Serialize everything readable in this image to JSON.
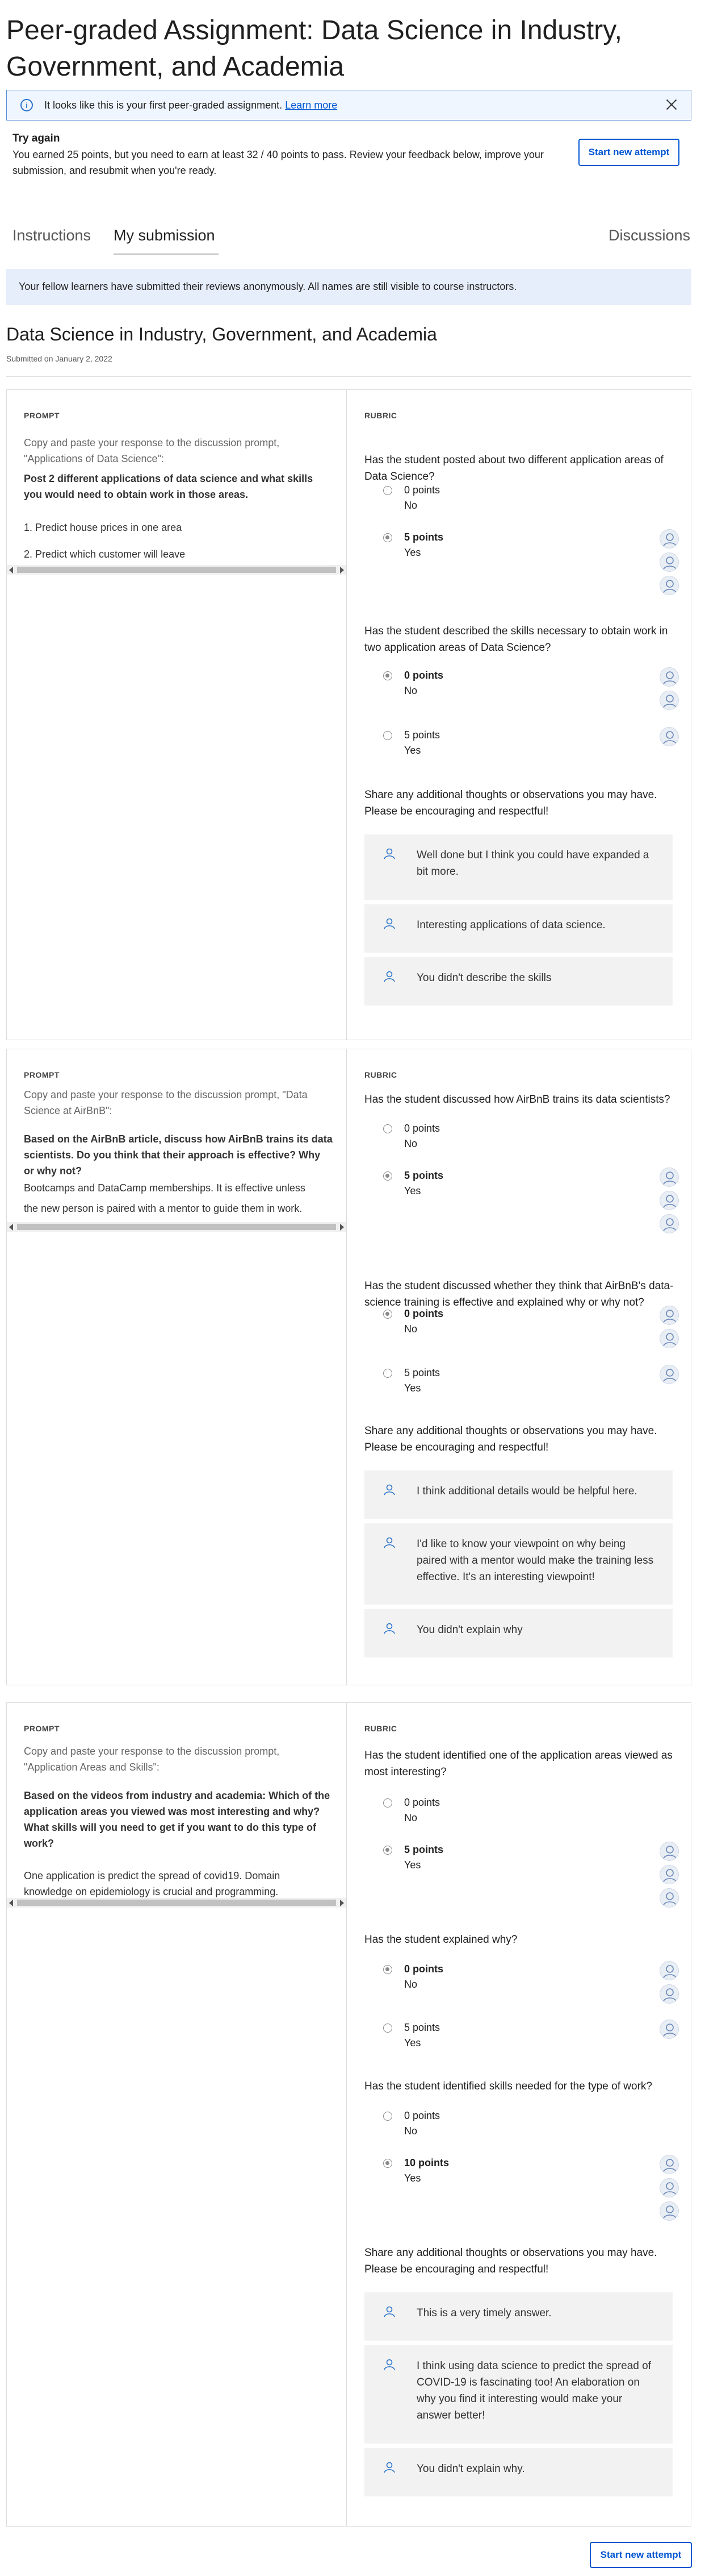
{
  "title": "Peer-graded Assignment: Data Science in Industry, Government, and Academia",
  "info_banner": {
    "icon": "info-icon",
    "text": "It looks like this is your first peer-graded assignment. ",
    "link": "Learn more",
    "close_icon": "close-icon"
  },
  "try_again": {
    "title": "Try again",
    "text": "You earned 25 points, but you need to earn at least 32 / 40 points to pass. Review your feedback below, improve your submission, and resubmit when you're ready.",
    "button": "Start new attempt"
  },
  "tabs": [
    {
      "label": "Instructions"
    },
    {
      "label": "My submission",
      "active": true
    },
    {
      "label": "Discussions"
    }
  ],
  "notice": "Your fellow learners have submitted their reviews anonymously. All names are still visible to course instructors.",
  "submission": {
    "title": "Data Science in Industry, Government, and Academia",
    "date": "Submitted on January 2, 2022"
  },
  "labels": {
    "prompt": "PROMPT",
    "rubric": "RUBRIC"
  },
  "sections": [
    {
      "prompt_intro": "Copy and paste your response to the discussion prompt, \"Applications of Data Science\":",
      "prompt_bold": "Post 2 different applications of data science and what skills you would need to obtain work in those areas.",
      "response": [
        "1. Predict house prices in one area",
        "2. Predict which customer will leave"
      ],
      "questions": [
        {
          "text": "Has the student posted about two different application areas of Data Science?",
          "options": [
            {
              "points": "0 points",
              "label": "No",
              "selected": false,
              "reviewers": 0
            },
            {
              "points": "5 points",
              "label": "Yes",
              "selected": true,
              "reviewers": 3
            }
          ]
        },
        {
          "text": "Has the student described the skills necessary to obtain work in two application areas of Data Science?",
          "options": [
            {
              "points": "0 points",
              "label": "No",
              "selected": true,
              "reviewers": 2
            },
            {
              "points": "5 points",
              "label": "Yes",
              "selected": false,
              "reviewers": 1
            }
          ]
        }
      ],
      "share_prompt": "Share any additional thoughts or observations you may have. Please be encouraging and respectful!",
      "feedback": [
        "Well done but I think you could have expanded a bit more.",
        "Interesting applications of data science.",
        "You didn't describe the skills"
      ]
    },
    {
      "prompt_intro": "Copy and paste your response to the discussion prompt, \"Data Science at AirBnB\":",
      "prompt_bold": "Based on the AirBnB article, discuss how AirBnB trains its data scientists. Do you think that their approach is effective? Why or why not?",
      "response": [
        "Bootcamps and DataCamp memberships. It is effective unless",
        "the new person is paired with a mentor to guide   them in work."
      ],
      "questions": [
        {
          "text": "Has the student discussed how AirBnB trains its data scientists?",
          "options": [
            {
              "points": "0 points",
              "label": "No",
              "selected": false,
              "reviewers": 0
            },
            {
              "points": "5 points",
              "label": "Yes",
              "selected": true,
              "reviewers": 3
            }
          ]
        },
        {
          "text": "Has the student discussed whether they think that AirBnB's data-science training is effective and explained why or why not?",
          "options": [
            {
              "points": "0 points",
              "label": "No",
              "selected": true,
              "reviewers": 2
            },
            {
              "points": "5 points",
              "label": "Yes",
              "selected": false,
              "reviewers": 1
            }
          ]
        }
      ],
      "share_prompt": "Share any additional thoughts or observations you may have. Please be encouraging and respectful!",
      "feedback": [
        "I think additional details would be helpful here.",
        "I'd like to know your viewpoint on why being paired with a mentor would make the training less effective. It's an interesting viewpoint!",
        "You didn't explain why"
      ]
    },
    {
      "prompt_intro": "Copy and paste your response to the discussion prompt, \"Application Areas and Skills\":",
      "prompt_bold": "Based on the videos from industry and academia: Which of the application areas you viewed was most interesting and why?  What skills will you need to get if you want to do this type of work?",
      "response": [
        "One application is predict the spread of covid19. Domain",
        "knowledge on epidemiology is crucial and programming."
      ],
      "questions": [
        {
          "text": "Has the student identified one of the application areas viewed as most interesting?",
          "options": [
            {
              "points": "0 points",
              "label": "No",
              "selected": false,
              "reviewers": 0
            },
            {
              "points": "5 points",
              "label": "Yes",
              "selected": true,
              "reviewers": 3
            }
          ]
        },
        {
          "text": "Has the student explained why?",
          "options": [
            {
              "points": "0 points",
              "label": "No",
              "selected": true,
              "reviewers": 2
            },
            {
              "points": "5 points",
              "label": "Yes",
              "selected": false,
              "reviewers": 1
            }
          ]
        },
        {
          "text": "Has the student identified skills needed for the type of work?",
          "options": [
            {
              "points": "0 points",
              "label": "No",
              "selected": false,
              "reviewers": 0
            },
            {
              "points": "10 points",
              "label": "Yes",
              "selected": true,
              "reviewers": 3
            }
          ]
        }
      ],
      "share_prompt": "Share any additional thoughts or observations you may have. Please be encouraging and respectful!",
      "feedback": [
        "This is a very timely answer.",
        "I think using data science to predict the spread of COVID-19 is fascinating too! An elaboration on why you find it interesting would make your answer better!",
        "You didn't explain why."
      ]
    }
  ],
  "bottom_button": "Start new attempt",
  "colors": {
    "link": "#0056d2",
    "banner_bg": "#f0f6ff",
    "notice_bg": "#e6eefb",
    "feedback_bg": "#f2f2f2"
  }
}
